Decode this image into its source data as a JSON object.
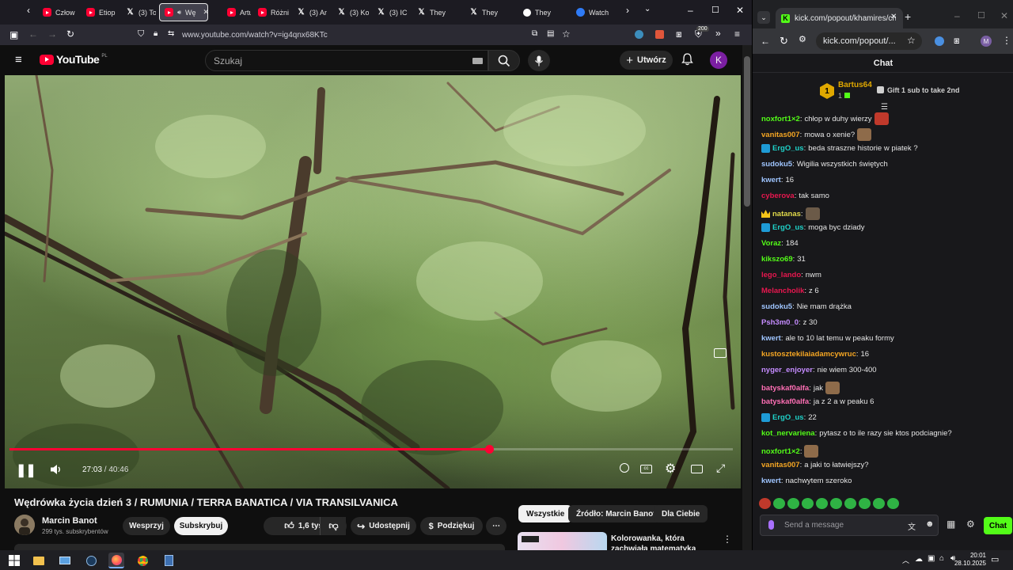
{
  "firefox": {
    "tabs": [
      {
        "label": "Człow",
        "icon": "youtube-icon"
      },
      {
        "label": "Etiop",
        "icon": "youtube-icon"
      },
      {
        "label": "(3) To",
        "icon": "x-icon"
      },
      {
        "label": "Wę",
        "icon": "youtube-icon",
        "active": true
      },
      {
        "label": "Artur",
        "icon": "youtube-icon"
      },
      {
        "label": "Różni",
        "icon": "youtube-icon"
      },
      {
        "label": "(3) An",
        "icon": "x-icon"
      },
      {
        "label": "(3) Ko",
        "icon": "x-icon"
      },
      {
        "label": "(3) IC",
        "icon": "x-icon"
      },
      {
        "label": "They",
        "icon": "x-icon"
      },
      {
        "label": "They",
        "icon": "x-icon"
      },
      {
        "label": "They",
        "icon": "threads-icon"
      },
      {
        "label": "Watch",
        "icon": "watch-icon"
      }
    ],
    "url": "www.youtube.com/watch?v=ig4qnx68KTc",
    "extension_badge": "200"
  },
  "youtube": {
    "logo_text": "YouTube",
    "logo_region": "PL",
    "search_placeholder": "Szukaj",
    "create_label": "Utwórz",
    "avatar_letter": "K",
    "player": {
      "current_time": "27:03",
      "separator": " / ",
      "duration": "40:46",
      "progress_fraction": 0.6635
    },
    "video_title": "Wędrówka życia dzień 3 / RUMUNIA / TERRA BANATICA / VIA TRANSILVANICA",
    "channel_name": "Marcin Banot",
    "channel_subs": "299 tys. subskrybentów",
    "support_label": "Wesprzyj",
    "subscribe_label": "Subskrybuj",
    "like_count": "1,6 tys.",
    "share_label": "Udostępnij",
    "thanks_label": "Podziękuj",
    "chips": [
      "Wszystkie",
      "Źródło: Marcin Banot",
      "Dla Ciebie"
    ],
    "reco_title": "Kolorowanka, która zachwiała matematyką"
  },
  "chrome": {
    "tab_title": "kick.com/popout/khamires/cha",
    "url": "kick.com/popout/...",
    "profile_letter": "M"
  },
  "kick": {
    "chat_title": "Chat",
    "pinned_rank": "1",
    "pinned_user": "Bartus64",
    "pinned_count": "1",
    "gift_text": "Gift 1 sub to take 2nd",
    "messages": [
      {
        "user": "noxfort1×2",
        "color": "#53fc18",
        "text": "chłop w duhy wierzy",
        "emote": true
      },
      {
        "user": "vanitas007",
        "color": "#f5a623",
        "text": "mowa o xenie?",
        "emote": true
      },
      {
        "user": "ErgO_us",
        "color": "#1fd1c8",
        "text": "beda straszne historie w piatek ?",
        "badge": "sub"
      },
      {
        "user": "sudoku5",
        "color": "#9fc5ff",
        "text": "Wigilia wszystkich świętych"
      },
      {
        "user": "kwert",
        "color": "#9fc5ff",
        "text": "16"
      },
      {
        "user": "cyberova",
        "color": "#e8174f",
        "text": "tak samo"
      },
      {
        "user": "natanas",
        "color": "#e0d94a",
        "text": "",
        "badge": "crown",
        "emote": true
      },
      {
        "user": "ErgO_us",
        "color": "#1fd1c8",
        "text": "moga byc dziady",
        "badge": "sub"
      },
      {
        "user": "Voraz",
        "color": "#53fc18",
        "text": "184"
      },
      {
        "user": "kikszo69",
        "color": "#53fc18",
        "text": "31"
      },
      {
        "user": "lego_lando",
        "color": "#e8174f",
        "text": "nwm"
      },
      {
        "user": "Melancholik",
        "color": "#e8174f",
        "text": "z 6"
      },
      {
        "user": "sudoku5",
        "color": "#9fc5ff",
        "text": "Nie mam drążka"
      },
      {
        "user": "Psh3m0_0",
        "color": "#c58cff",
        "text": "z 30"
      },
      {
        "user": "kwert",
        "color": "#9fc5ff",
        "text": "ale to 10 lat temu w peaku formy"
      },
      {
        "user": "kustosztekilaiadamcywruc",
        "color": "#f5a623",
        "text": "16"
      },
      {
        "user": "nyger_enjoyer",
        "color": "#c58cff",
        "text": "nie wiem 300-400"
      },
      {
        "user": "batyskaf0alfa",
        "color": "#ff6fb5",
        "text": "jak",
        "emote": true
      },
      {
        "user": "batyskaf0alfa",
        "color": "#ff6fb5",
        "text": "ja z 2 a w peaku 6"
      },
      {
        "user": "ErgO_us",
        "color": "#1fd1c8",
        "text": "22",
        "badge": "sub"
      },
      {
        "user": "kot_nervariena",
        "color": "#53fc18",
        "text": "pytasz o to ile razy sie ktos podciagnie?"
      },
      {
        "user": "noxfort1×2",
        "color": "#53fc18",
        "text": "",
        "emote": true
      },
      {
        "user": "vanitas007",
        "color": "#f5a623",
        "text": "a jaki to łatwiejszy?"
      },
      {
        "user": "kwert",
        "color": "#9fc5ff",
        "text": "nachwytem szeroko"
      }
    ],
    "send_placeholder": "Send a message",
    "chat_button": "Chat"
  },
  "taskbar": {
    "time": "20:01",
    "date": "28.10.2025"
  },
  "colors": {
    "youtube_red": "#ff0033",
    "kick_green": "#53fc18",
    "pinned_gold": "#e0a800"
  }
}
